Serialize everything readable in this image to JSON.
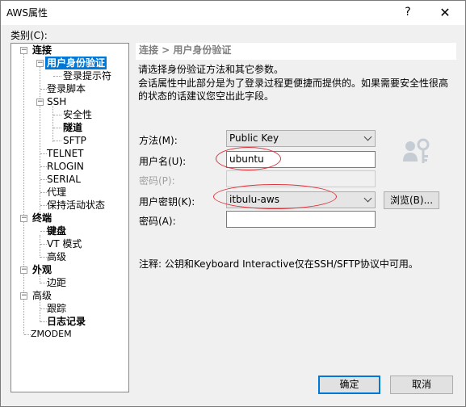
{
  "window": {
    "title": "AWS属性",
    "help": "?",
    "close": "✕"
  },
  "category": {
    "label": "类别(C):"
  },
  "tree": {
    "connect": "连接",
    "auth": "用户身份验证",
    "login_prompts": "登录提示符",
    "login_script": "登录脚本",
    "ssh": "SSH",
    "security": "安全性",
    "tunnel": "隧道",
    "sftp": "SFTP",
    "telnet": "TELNET",
    "rlogin": "RLOGIN",
    "serial": "SERIAL",
    "proxy": "代理",
    "keepalive": "保持活动状态",
    "terminal": "终端",
    "keyboard": "键盘",
    "vt_mode": "VT 模式",
    "advanced_term": "高级",
    "appearance": "外观",
    "margins": "边距",
    "advanced": "高级",
    "trace": "跟踪",
    "logging": "日志记录",
    "zmodem": "ZMODEM"
  },
  "panel": {
    "header": "连接 > 用户身份验证",
    "desc1": "请选择身份验证方法和其它参数。",
    "desc2": "会话属性中此部分是为了登录过程更便捷而提供的。如果需要安全性很高的状态的话建议您空出此字段。",
    "method_label": "方法(M):",
    "method_value": "Public Key",
    "username_label": "用户名(U):",
    "username_value": "ubuntu",
    "password_label": "密码(P):",
    "password_value": "",
    "userkey_label": "用户密钥(K):",
    "userkey_value": "itbulu-aws",
    "browse": "浏览(B)...",
    "passphrase_label": "密码(A):",
    "passphrase_value": "",
    "note": "注释: 公钥和Keyboard Interactive仅在SSH/SFTP协议中可用。"
  },
  "footer": {
    "ok": "确定",
    "cancel": "取消"
  },
  "colors": {
    "selection": "#0078d7",
    "annotation": "#e0303a"
  }
}
